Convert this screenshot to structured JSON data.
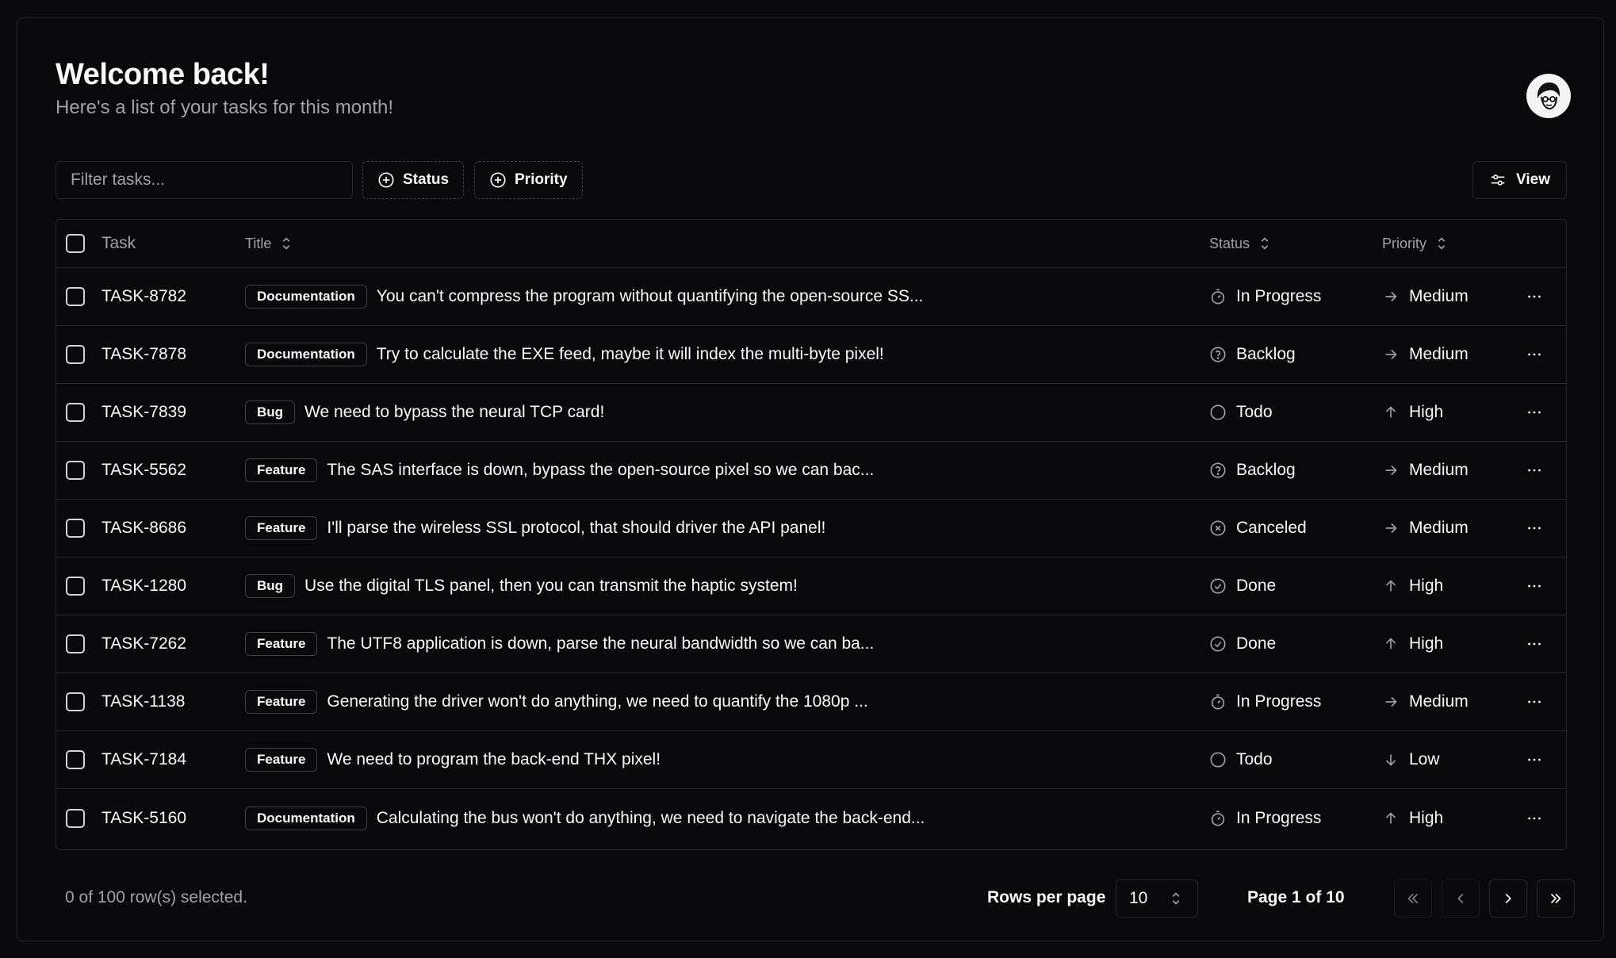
{
  "header": {
    "title": "Welcome back!",
    "subtitle": "Here's a list of your tasks for this month!"
  },
  "toolbar": {
    "filter_placeholder": "Filter tasks...",
    "status_label": "Status",
    "priority_label": "Priority",
    "view_label": "View"
  },
  "table": {
    "columns": {
      "task": "Task",
      "title": "Title",
      "status": "Status",
      "priority": "Priority"
    },
    "rows": [
      {
        "id": "TASK-8782",
        "label": "Documentation",
        "title": "You can't compress the program without quantifying the open-source SS...",
        "status": "In Progress",
        "status_icon": "timer-icon",
        "priority": "Medium",
        "priority_icon": "arrow-right-icon"
      },
      {
        "id": "TASK-7878",
        "label": "Documentation",
        "title": "Try to calculate the EXE feed, maybe it will index the multi-byte pixel!",
        "status": "Backlog",
        "status_icon": "help-circle-icon",
        "priority": "Medium",
        "priority_icon": "arrow-right-icon"
      },
      {
        "id": "TASK-7839",
        "label": "Bug",
        "title": "We need to bypass the neural TCP card!",
        "status": "Todo",
        "status_icon": "circle-icon",
        "priority": "High",
        "priority_icon": "arrow-up-icon"
      },
      {
        "id": "TASK-5562",
        "label": "Feature",
        "title": "The SAS interface is down, bypass the open-source pixel so we can bac...",
        "status": "Backlog",
        "status_icon": "help-circle-icon",
        "priority": "Medium",
        "priority_icon": "arrow-right-icon"
      },
      {
        "id": "TASK-8686",
        "label": "Feature",
        "title": "I'll parse the wireless SSL protocol, that should driver the API panel!",
        "status": "Canceled",
        "status_icon": "x-circle-icon",
        "priority": "Medium",
        "priority_icon": "arrow-right-icon"
      },
      {
        "id": "TASK-1280",
        "label": "Bug",
        "title": "Use the digital TLS panel, then you can transmit the haptic system!",
        "status": "Done",
        "status_icon": "check-circle-icon",
        "priority": "High",
        "priority_icon": "arrow-up-icon"
      },
      {
        "id": "TASK-7262",
        "label": "Feature",
        "title": "The UTF8 application is down, parse the neural bandwidth so we can ba...",
        "status": "Done",
        "status_icon": "check-circle-icon",
        "priority": "High",
        "priority_icon": "arrow-up-icon"
      },
      {
        "id": "TASK-1138",
        "label": "Feature",
        "title": "Generating the driver won't do anything, we need to quantify the 1080p ...",
        "status": "In Progress",
        "status_icon": "timer-icon",
        "priority": "Medium",
        "priority_icon": "arrow-right-icon"
      },
      {
        "id": "TASK-7184",
        "label": "Feature",
        "title": "We need to program the back-end THX pixel!",
        "status": "Todo",
        "status_icon": "circle-icon",
        "priority": "Low",
        "priority_icon": "arrow-down-icon"
      },
      {
        "id": "TASK-5160",
        "label": "Documentation",
        "title": "Calculating the bus won't do anything, we need to navigate the back-end...",
        "status": "In Progress",
        "status_icon": "timer-icon",
        "priority": "High",
        "priority_icon": "arrow-up-icon"
      }
    ]
  },
  "footer": {
    "selected_text": "0 of 100 row(s) selected.",
    "rows_per_page_label": "Rows per page",
    "rows_per_page_value": "10",
    "page_label": "Page 1 of 10"
  }
}
